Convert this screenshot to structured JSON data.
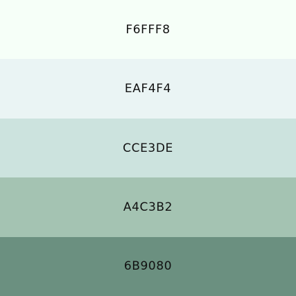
{
  "palette": {
    "swatches": [
      {
        "label": "F6FFF8",
        "color": "#F6FFF8"
      },
      {
        "label": "EAF4F4",
        "color": "#EAF4F4"
      },
      {
        "label": "CCE3DE",
        "color": "#CCE3DE"
      },
      {
        "label": "A4C3B2",
        "color": "#A4C3B2"
      },
      {
        "label": "6B9080",
        "color": "#6B9080"
      }
    ]
  }
}
